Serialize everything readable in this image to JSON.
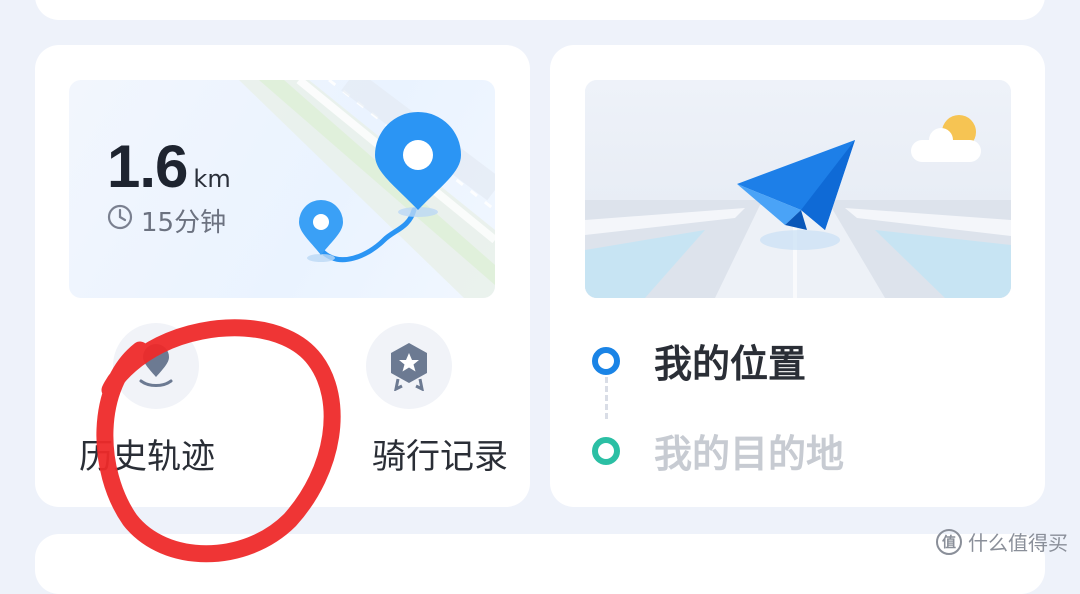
{
  "trip_card": {
    "distance_value": "1.6",
    "distance_unit": "km",
    "duration": "15分钟"
  },
  "actions": {
    "history_label": "历史轨迹",
    "ride_records_label": "骑行记录"
  },
  "navigation_card": {
    "my_location_label": "我的位置",
    "destination_label": "我的目的地"
  },
  "icons": {
    "clock": "clock-icon",
    "map_pin": "map-pin-icon",
    "history": "history-route-icon",
    "ride_badge": "ride-badge-icon",
    "paper_plane": "paper-plane-icon",
    "sun_cloud": "sun-cloud-icon"
  },
  "colors": {
    "start_dot": "#1a84e6",
    "destination_dot": "#2bbfa4",
    "destination_text": "#c7cbd2",
    "pin_blue": "#2b95f4",
    "annotation_red": "#ee2a2a"
  },
  "watermark": {
    "logo": "值",
    "text": "什么值得买"
  }
}
